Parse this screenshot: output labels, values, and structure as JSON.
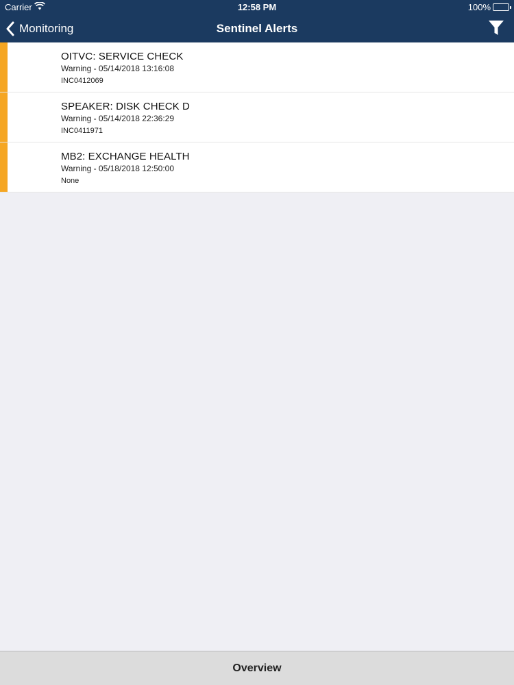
{
  "status_bar": {
    "carrier": "Carrier",
    "time": "12:58 PM",
    "battery": "100%"
  },
  "nav": {
    "back_label": "Monitoring",
    "title": "Sentinel Alerts",
    "filter_icon": "filter-icon"
  },
  "alerts": [
    {
      "name": "OITVC: SERVICE CHECK",
      "meta": "Warning - 05/14/2018 13:16:08",
      "incident": "INC0412069"
    },
    {
      "name": "SPEAKER: DISK CHECK D",
      "meta": "Warning - 05/14/2018 22:36:29",
      "incident": "INC0411971"
    },
    {
      "name": "MB2: EXCHANGE HEALTH",
      "meta": "Warning - 05/18/2018 12:50:00",
      "incident": "None"
    }
  ],
  "tab_bar": {
    "overview_label": "Overview"
  },
  "colors": {
    "nav_background": "#1b3a60",
    "warning_stripe": "#f5a623",
    "page_background": "#efeff4"
  }
}
